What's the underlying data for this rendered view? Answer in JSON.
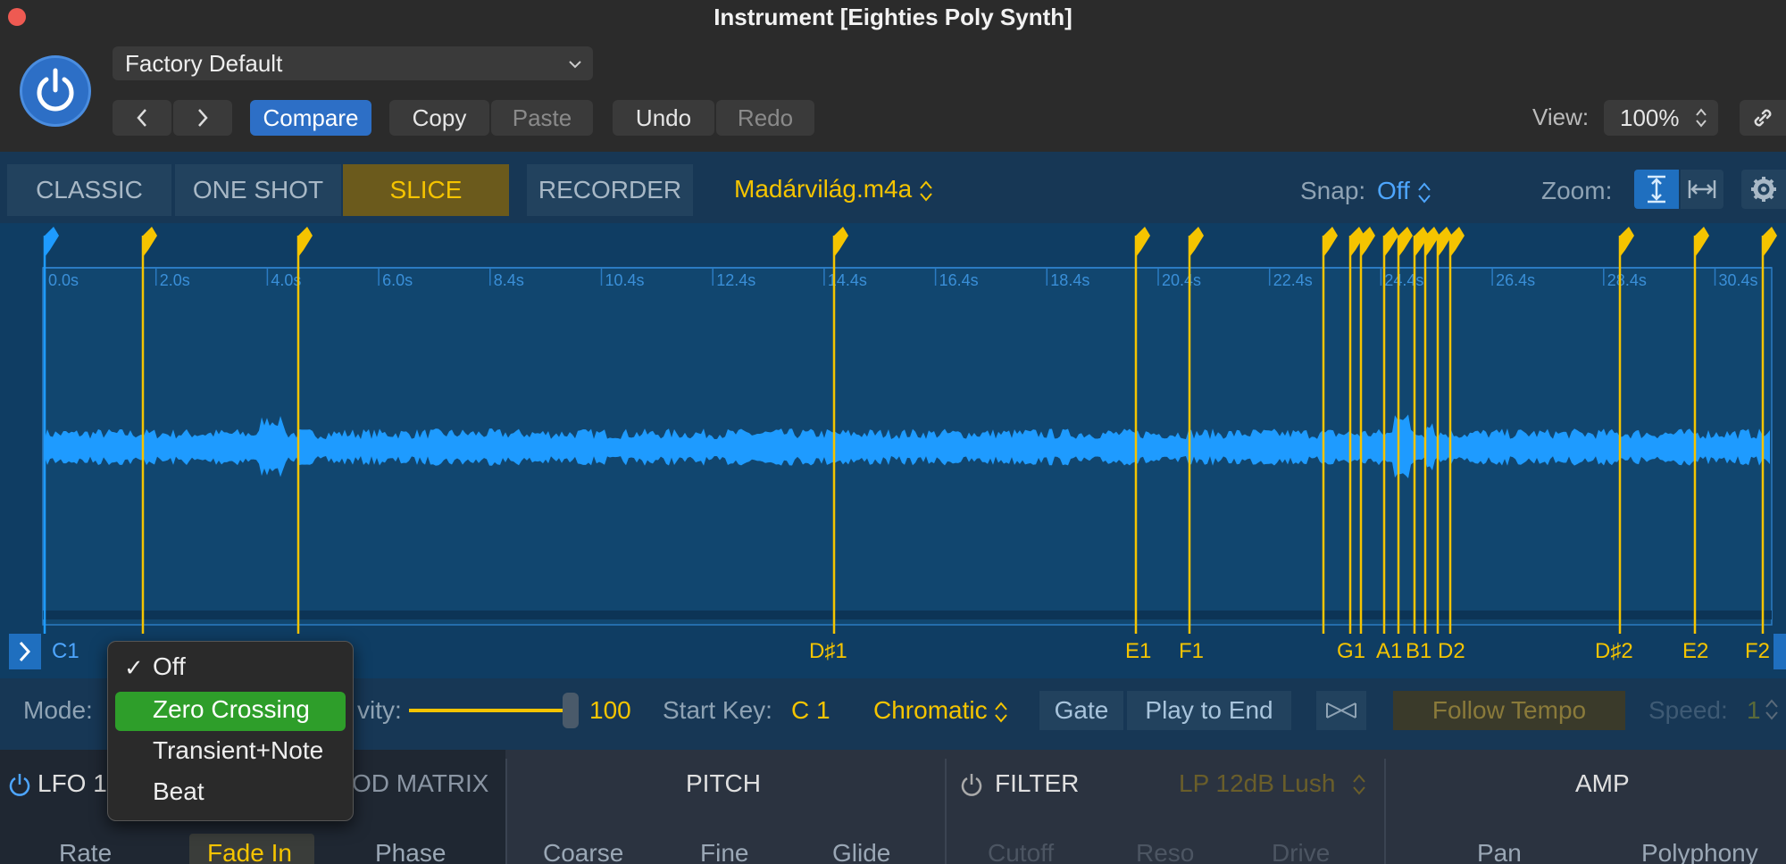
{
  "window": {
    "title": "Instrument [Eighties Poly Synth]"
  },
  "header": {
    "preset": "Factory Default",
    "prev_label": "‹",
    "next_label": "›",
    "compare": "Compare",
    "copy": "Copy",
    "paste": "Paste",
    "undo": "Undo",
    "redo": "Redo",
    "view_label": "View:",
    "view_value": "100%"
  },
  "modes": {
    "classic": "CLASSIC",
    "one_shot": "ONE SHOT",
    "slice": "SLICE",
    "recorder": "RECORDER",
    "active": "SLICE"
  },
  "file": {
    "name": "Madárvilág.m4a"
  },
  "snap": {
    "label": "Snap:",
    "value": "Off"
  },
  "zoom": {
    "label": "Zoom:"
  },
  "timeline": {
    "ticks": [
      "0.0s",
      "2.0s",
      "4.0s",
      "6.0s",
      "8.4s",
      "10.4s",
      "12.4s",
      "14.4s",
      "16.4s",
      "18.4s",
      "20.4s",
      "22.4s",
      "24.4s",
      "26.4s",
      "28.4s",
      "30.4s"
    ]
  },
  "slices": {
    "start_note": "C1",
    "notes": [
      "D♯1",
      "E1",
      "F1",
      "G1",
      "A1",
      "B1",
      "D2",
      "D♯2",
      "E2",
      "F2"
    ]
  },
  "controls": {
    "mode_label": "Mode:",
    "sensitivity_label": "vity:",
    "sensitivity_value": "100",
    "start_key_label": "Start Key:",
    "start_key_value": "C 1",
    "scale": "Chromatic",
    "gate": "Gate",
    "play_to_end": "Play to End",
    "follow_tempo": "Follow Tempo",
    "speed_label": "Speed:",
    "speed_value": "1"
  },
  "mode_menu": {
    "checked": "Off",
    "items": [
      "Off",
      "Zero Crossing",
      "Transient+Note",
      "Beat"
    ],
    "highlighted": "Zero Crossing"
  },
  "panels": {
    "lfo": "LFO 1",
    "mod_matrix": "OD MATRIX",
    "pitch": "PITCH",
    "filter": "FILTER",
    "filter_type": "LP 12dB Lush",
    "amp": "AMP",
    "rate": "Rate",
    "fade_in": "Fade In",
    "phase": "Phase",
    "coarse": "Coarse",
    "fine": "Fine",
    "glide": "Glide",
    "cutoff": "Cutoff",
    "reso": "Reso",
    "drive": "Drive",
    "pan": "Pan",
    "polyphony": "Polyphony"
  },
  "colors": {
    "accent": "#f5c400",
    "wave": "#1e9bff",
    "bg": "#0f3d63"
  }
}
